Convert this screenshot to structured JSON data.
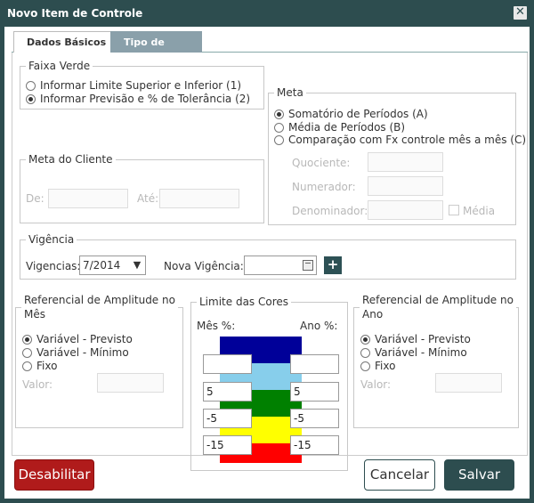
{
  "window": {
    "title": "Novo Item de Controle",
    "close_symbol": "✕"
  },
  "tabs": [
    {
      "label": "Dados Básicos",
      "active": false
    },
    {
      "label": "Tipo de Item",
      "active": true
    }
  ],
  "faixa_verde": {
    "legend": "Faixa Verde",
    "options": [
      {
        "label": "Informar Limite Superior e Inferior (1)",
        "selected": false
      },
      {
        "label": "Informar Previsão e % de Tolerância (2)",
        "selected": true
      }
    ]
  },
  "meta_cliente": {
    "legend": "Meta do Cliente",
    "de_label": "De:",
    "ate_label": "Até:",
    "de_value": "",
    "ate_value": ""
  },
  "meta": {
    "legend": "Meta",
    "options": [
      {
        "label": "Somatório de Períodos (A)",
        "selected": true
      },
      {
        "label": "Média de Períodos (B)",
        "selected": false
      },
      {
        "label": "Comparação com Fx controle mês a mês (C)",
        "selected": false
      }
    ],
    "quociente_label": "Quociente:",
    "numerador_label": "Numerador:",
    "denominador_label": "Denominador:",
    "media_label": "Média",
    "media_checked": false
  },
  "vigencia": {
    "legend": "Vigência",
    "vigencias_label": "Vigencias:",
    "vigencias_value": "7/2014",
    "nova_label": "Nova Vigência:",
    "nova_value": "",
    "add_symbol": "+"
  },
  "ref_mes": {
    "legend_line1": "Referencial de Amplitude no",
    "legend_line2": "Mês",
    "options": [
      {
        "label": "Variável - Previsto",
        "selected": true
      },
      {
        "label": "Variável - Mínimo",
        "selected": false
      },
      {
        "label": "Fixo",
        "selected": false
      }
    ],
    "valor_label": "Valor:",
    "valor_value": ""
  },
  "limite_cores": {
    "legend": "Limite das Cores",
    "mes_label": "Mês %:",
    "ano_label": "Ano %:",
    "band_colors": [
      "#000099",
      "#87ceeb",
      "#008000",
      "#ffff00",
      "#ff0000"
    ],
    "mes_values": [
      "",
      "5",
      "-5",
      "-15"
    ],
    "ano_values": [
      "",
      "5",
      "-5",
      "-15"
    ]
  },
  "ref_ano": {
    "legend_line1": "Referencial de Amplitude no",
    "legend_line2": "Ano",
    "options": [
      {
        "label": "Variável - Previsto",
        "selected": true
      },
      {
        "label": "Variável - Mínimo",
        "selected": false
      },
      {
        "label": "Fixo",
        "selected": false
      }
    ],
    "valor_label": "Valor:",
    "valor_value": ""
  },
  "buttons": {
    "disable": "Desabilitar",
    "cancel": "Cancelar",
    "save": "Salvar"
  }
}
